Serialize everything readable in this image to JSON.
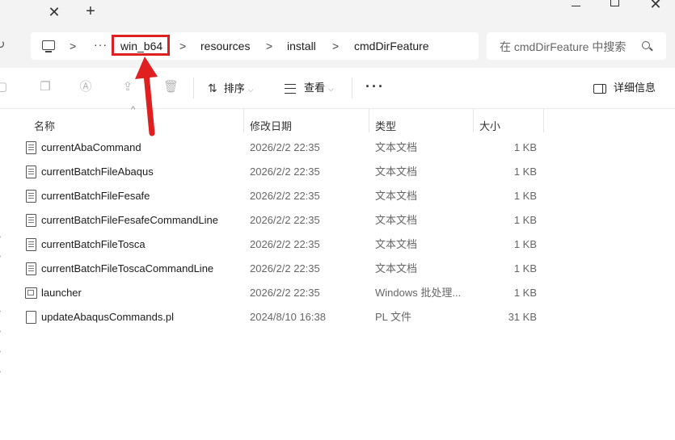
{
  "window": {
    "tab_close": "✕",
    "tab_add": "+",
    "close": "✕"
  },
  "address": {
    "more": "···",
    "separator": ">",
    "crumbs": [
      "win_b64",
      "resources",
      "install",
      "cmdDirFeature"
    ],
    "highlight_color": "#e02020"
  },
  "search": {
    "placeholder": "在 cmdDirFeature 中搜索"
  },
  "toolbar": {
    "sort_label": "排序",
    "view_label": "查看",
    "more_label": "···",
    "details_label": "详细信息"
  },
  "columns": {
    "name": "名称",
    "date": "修改日期",
    "type": "类型",
    "size": "大小"
  },
  "files": [
    {
      "name": "currentAbaCommand",
      "date": "2026/2/2 22:35",
      "type": "文本文档",
      "size": "1 KB",
      "icon": "text-file-icon"
    },
    {
      "name": "currentBatchFileAbaqus",
      "date": "2026/2/2 22:35",
      "type": "文本文档",
      "size": "1 KB",
      "icon": "text-file-icon"
    },
    {
      "name": "currentBatchFileFesafe",
      "date": "2026/2/2 22:35",
      "type": "文本文档",
      "size": "1 KB",
      "icon": "text-file-icon"
    },
    {
      "name": "currentBatchFileFesafeCommandLine",
      "date": "2026/2/2 22:35",
      "type": "文本文档",
      "size": "1 KB",
      "icon": "text-file-icon"
    },
    {
      "name": "currentBatchFileTosca",
      "date": "2026/2/2 22:35",
      "type": "文本文档",
      "size": "1 KB",
      "icon": "text-file-icon"
    },
    {
      "name": "currentBatchFileToscaCommandLine",
      "date": "2026/2/2 22:35",
      "type": "文本文档",
      "size": "1 KB",
      "icon": "text-file-icon"
    },
    {
      "name": "launcher",
      "date": "2026/2/2 22:35",
      "type": "Windows 批处理...",
      "size": "1 KB",
      "icon": "batch-file-icon"
    },
    {
      "name": "updateAbaqusCommands.pl",
      "date": "2024/8/10 16:38",
      "type": "PL 文件",
      "size": "31 KB",
      "icon": "blank-file-icon"
    }
  ]
}
